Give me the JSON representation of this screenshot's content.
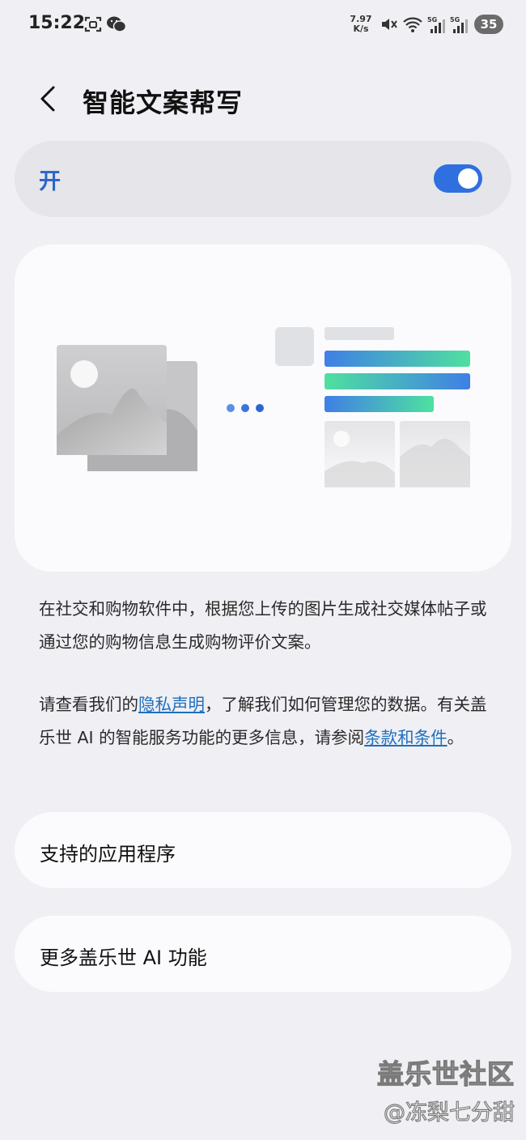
{
  "status_bar": {
    "time": "15:22",
    "net_speed": "7.97",
    "net_speed_unit": "K/s",
    "signal_1_label": "5G",
    "signal_2_label": "5G",
    "battery": "35"
  },
  "header": {
    "title": "智能文案帮写"
  },
  "toggle": {
    "label": "开",
    "state": "on"
  },
  "description": "在社交和购物软件中，根据您上传的图片生成社交媒体帖子或通过您的购物信息生成购物评价文案。",
  "privacy": {
    "line1_before": "请查看我们的",
    "privacy_link": "隐私声明",
    "line1_after": "，了解我们如何管理您的数据。",
    "line2_before": "有关盖乐世 AI 的智能服务功能的更多信息，请参阅",
    "terms_link": "条款和条件",
    "line2_after": "。"
  },
  "menu": {
    "supported_apps": "支持的应用程序",
    "more_features": "更多盖乐世 AI 功能"
  },
  "watermark": {
    "community": "盖乐世社区",
    "author": "@冻梨七分甜"
  },
  "colors": {
    "accent": "#2f6fe0",
    "link": "#1e6fbf"
  }
}
